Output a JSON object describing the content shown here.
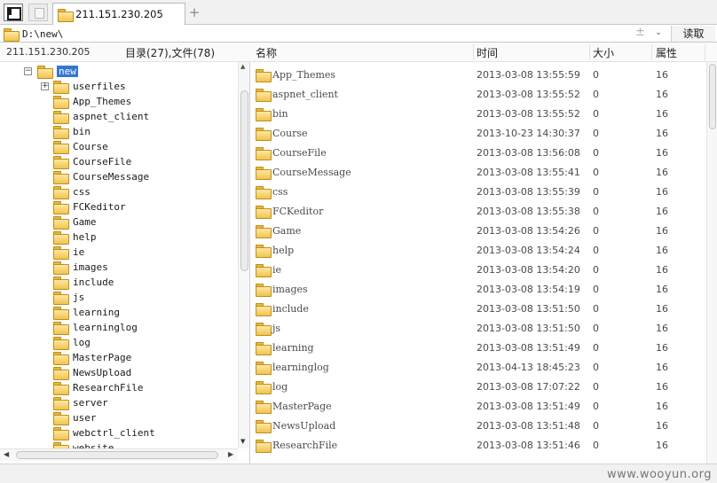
{
  "tabs": [
    {
      "label": "211.151.230.205"
    }
  ],
  "address": {
    "path": "D:\\new\\",
    "read_label": "读取",
    "add_glyph": "±",
    "dropdown_glyph": "⌄"
  },
  "left": {
    "ip": "211.151.230.205",
    "counts": "目录(27),文件(78)",
    "root": "new",
    "items": [
      "userfiles",
      "App_Themes",
      "aspnet_client",
      "bin",
      "Course",
      "CourseFile",
      "CourseMessage",
      "css",
      "FCKeditor",
      "Game",
      "help",
      "ie",
      "images",
      "include",
      "js",
      "learning",
      "learninglog",
      "log",
      "MasterPage",
      "NewsUpload",
      "ResearchFile",
      "server",
      "user",
      "webctrl_client",
      "website"
    ]
  },
  "columns": {
    "name": "名称",
    "time": "时间",
    "size": "大小",
    "attr": "属性"
  },
  "files": [
    {
      "name": "App_Themes",
      "time": "2013-03-08 13:55:59",
      "size": "0",
      "attr": "16"
    },
    {
      "name": "aspnet_client",
      "time": "2013-03-08 13:55:52",
      "size": "0",
      "attr": "16"
    },
    {
      "name": "bin",
      "time": "2013-03-08 13:55:52",
      "size": "0",
      "attr": "16"
    },
    {
      "name": "Course",
      "time": "2013-10-23 14:30:37",
      "size": "0",
      "attr": "16"
    },
    {
      "name": "CourseFile",
      "time": "2013-03-08 13:56:08",
      "size": "0",
      "attr": "16"
    },
    {
      "name": "CourseMessage",
      "time": "2013-03-08 13:55:41",
      "size": "0",
      "attr": "16"
    },
    {
      "name": "css",
      "time": "2013-03-08 13:55:39",
      "size": "0",
      "attr": "16"
    },
    {
      "name": "FCKeditor",
      "time": "2013-03-08 13:55:38",
      "size": "0",
      "attr": "16"
    },
    {
      "name": "Game",
      "time": "2013-03-08 13:54:26",
      "size": "0",
      "attr": "16"
    },
    {
      "name": "help",
      "time": "2013-03-08 13:54:24",
      "size": "0",
      "attr": "16"
    },
    {
      "name": "ie",
      "time": "2013-03-08 13:54:20",
      "size": "0",
      "attr": "16"
    },
    {
      "name": "images",
      "time": "2013-03-08 13:54:19",
      "size": "0",
      "attr": "16"
    },
    {
      "name": "include",
      "time": "2013-03-08 13:51:50",
      "size": "0",
      "attr": "16"
    },
    {
      "name": "js",
      "time": "2013-03-08 13:51:50",
      "size": "0",
      "attr": "16"
    },
    {
      "name": "learning",
      "time": "2013-03-08 13:51:49",
      "size": "0",
      "attr": "16"
    },
    {
      "name": "learninglog",
      "time": "2013-04-13 18:45:23",
      "size": "0",
      "attr": "16"
    },
    {
      "name": "log",
      "time": "2013-03-08 17:07:22",
      "size": "0",
      "attr": "16"
    },
    {
      "name": "MasterPage",
      "time": "2013-03-08 13:51:49",
      "size": "0",
      "attr": "16"
    },
    {
      "name": "NewsUpload",
      "time": "2013-03-08 13:51:48",
      "size": "0",
      "attr": "16"
    },
    {
      "name": "ResearchFile",
      "time": "2013-03-08 13:51:46",
      "size": "0",
      "attr": "16"
    }
  ],
  "watermark": "www.wooyun.org",
  "icons": {
    "folder": "folder-icon",
    "panel": "panel-toggle-icon",
    "doc": "document-icon"
  }
}
